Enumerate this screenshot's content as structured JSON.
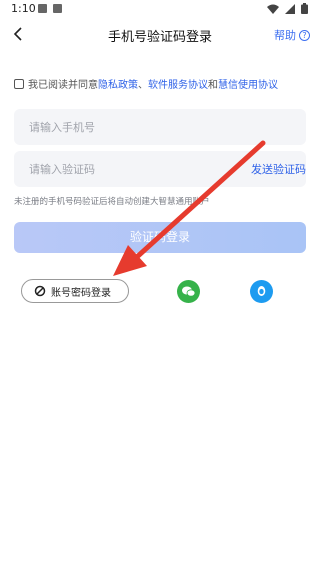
{
  "status": {
    "time": "1:10"
  },
  "nav": {
    "title": "手机号验证码登录",
    "help": "帮助",
    "help_icon": "?"
  },
  "agreement": {
    "prefix": "我已阅读并同意",
    "privacy": "隐私政策",
    "sep1": "、",
    "terms": "软件服务协议",
    "and": " 和 ",
    "usage": "慧信使用协议"
  },
  "form": {
    "phone_placeholder": "请输入手机号",
    "code_placeholder": "请输入验证码",
    "send_code": "发送验证码",
    "hint": "未注册的手机号码验证后将自动创建大智慧通用账户",
    "login": "验证码登录"
  },
  "alt": {
    "password_login": "账号密码登录"
  },
  "colors": {
    "link": "#2f62e8",
    "wechat": "#36b24a",
    "qq": "#1d9bf0",
    "arrow": "#e63b2e"
  }
}
